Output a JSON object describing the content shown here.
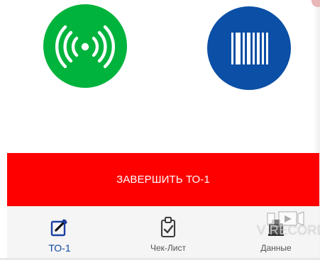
{
  "scan_actions": {
    "rfid_icon": "rfid-signal-icon",
    "rfid_color": "#00b33c",
    "barcode_icon": "barcode-icon",
    "barcode_color": "#0b4fa6"
  },
  "primary_action": {
    "label": "ЗАВЕРШИТЬ ТО-1",
    "color": "#ff0000"
  },
  "bottom_nav": {
    "items": [
      {
        "label": "ТО-1",
        "icon": "edit-icon",
        "active": true
      },
      {
        "label": "Чек-Лист",
        "icon": "clipboard-check-icon",
        "active": false
      },
      {
        "label": "Данные",
        "icon": "data-box-icon",
        "active": false
      }
    ],
    "active_color": "#0d47a1"
  },
  "watermark": {
    "text": "V RECORDER",
    "icon": "video-recorder-icon"
  }
}
